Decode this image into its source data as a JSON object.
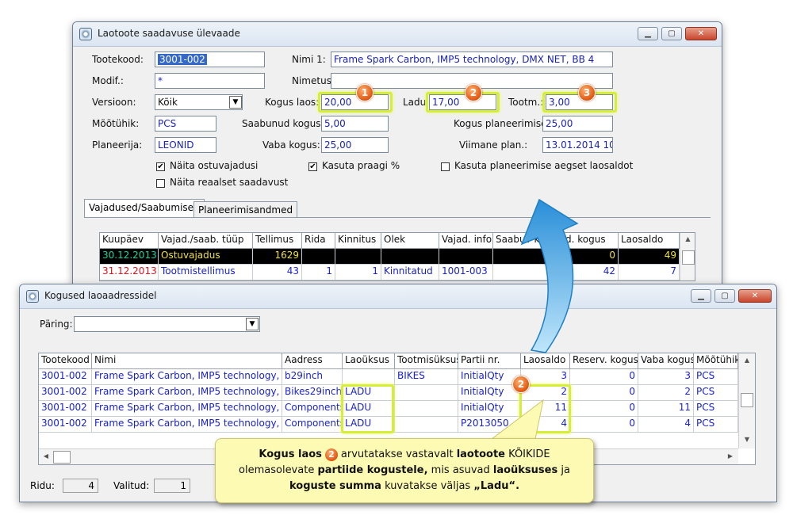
{
  "win1": {
    "title": "Laotoote saadavuse ülevaade",
    "fields": {
      "tootekood_label": "Tootekood:",
      "tootekood": "3001-002",
      "nimi1_label": "Nimi 1:",
      "nimi1": "Frame Spark Carbon, IMP5 technology, DMX NET, BB 4",
      "modif_label": "Modif.:",
      "modif": "*",
      "nimetus_label": "Nimetus:",
      "nimetus": "",
      "versioon_label": "Versioon:",
      "versioon": "Kõik",
      "kogus_laos_label": "Kogus laos:",
      "kogus_laos": "20,00",
      "ladu_label": "Ladu:",
      "ladu": "17,00",
      "tootm_label": "Tootm.:",
      "tootm": "3,00",
      "mootuhik_label": "Mõõtühik:",
      "mootuhik": "PCS",
      "saabunud_label": "Saabunud kogus:",
      "saabunud": "5,00",
      "kogus_plan_label": "Kogus planeerimisel:",
      "kogus_plan": "25,00",
      "planeerija_label": "Planeerija:",
      "planeerija": "LEONID",
      "vaba_label": "Vaba kogus:",
      "vaba": "25,00",
      "viimane_label": "Viimane plan.:",
      "viimane": "13.01.2014 10:04:46"
    },
    "badges": [
      "1",
      "2",
      "3"
    ],
    "checkboxes": {
      "naita_ostu": "Näita ostuvajadusi",
      "kasuta_praagi": "Kasuta praagi %",
      "kasuta_plan": "Kasuta planeerimise aegset laosaldot",
      "naita_reaalset": "Näita reaalset saadavust"
    },
    "tabs": [
      "Vajadused/Saabumised",
      "Planeerimisandmed"
    ],
    "grid": {
      "headers": [
        "Kuupäev",
        "Vajad./saab. tüüp",
        "Tellimus",
        "Rida",
        "Kinnitus",
        "Olek",
        "Vajad. info",
        "Saabuv kogus",
        "d. kogus",
        "Laosaldo"
      ],
      "rows": [
        [
          "30.12.2013",
          "Ostuvajadus",
          "1629",
          "",
          "",
          "",
          "",
          "24",
          "0",
          "49"
        ],
        [
          "31.12.2013",
          "Tootmistellimus",
          "43",
          "1",
          "1",
          "Kinnitatud",
          "1001-003",
          "0",
          "42",
          "7"
        ]
      ]
    }
  },
  "win2": {
    "title": "Kogused laoaadressidel",
    "paring_label": "Päring:",
    "paring_value": "",
    "headers": [
      "Tootekood",
      "Nimi",
      "Aadress",
      "Laoüksus",
      "Tootmisüksus",
      "Partii nr.",
      "Laosaldo",
      "Reserv. kogus",
      "Vaba kogus",
      "Mõõtühik"
    ],
    "rows": [
      [
        "3001-002",
        "Frame Spark Carbon, IMP5 technology, DMX",
        "b29inch",
        "",
        "BIKES",
        "InitialQty",
        "3",
        "0",
        "3",
        "PCS"
      ],
      [
        "3001-002",
        "Frame Spark Carbon, IMP5 technology, DMX",
        "Bikes29inch",
        "LADU",
        "",
        "InitialQty",
        "2",
        "0",
        "2",
        "PCS"
      ],
      [
        "3001-002",
        "Frame Spark Carbon, IMP5 technology, DMX",
        "Components",
        "LADU",
        "",
        "InitialQty",
        "11",
        "0",
        "11",
        "PCS"
      ],
      [
        "3001-002",
        "Frame Spark Carbon, IMP5 technology, DMX",
        "Components",
        "LADU",
        "",
        "P2013050",
        "4",
        "0",
        "4",
        "PCS"
      ]
    ],
    "badge": "2",
    "status": {
      "ridu_label": "Ridu:",
      "ridu": "4",
      "valitud_label": "Valitud:",
      "valitud": "1"
    }
  },
  "callout": {
    "p1": "Kogus laos",
    "badge": "2",
    "p2": "arvutatakse vastavalt",
    "p3": "laotoote",
    "p4": "KÕIKIDE olemasolevate",
    "p5": "partiide kogustele,",
    "p6": "mis asuvad",
    "p7": "laoüksuses",
    "p8": "ja",
    "p9": "koguste summa",
    "p10": "kuvatakse väljas",
    "p11": "„Ladu“."
  },
  "colors": {
    "badge": "#e0560f",
    "highlight": "#d7ee38",
    "arrow": "#3aa0e0",
    "callout": "#fdfab4"
  }
}
